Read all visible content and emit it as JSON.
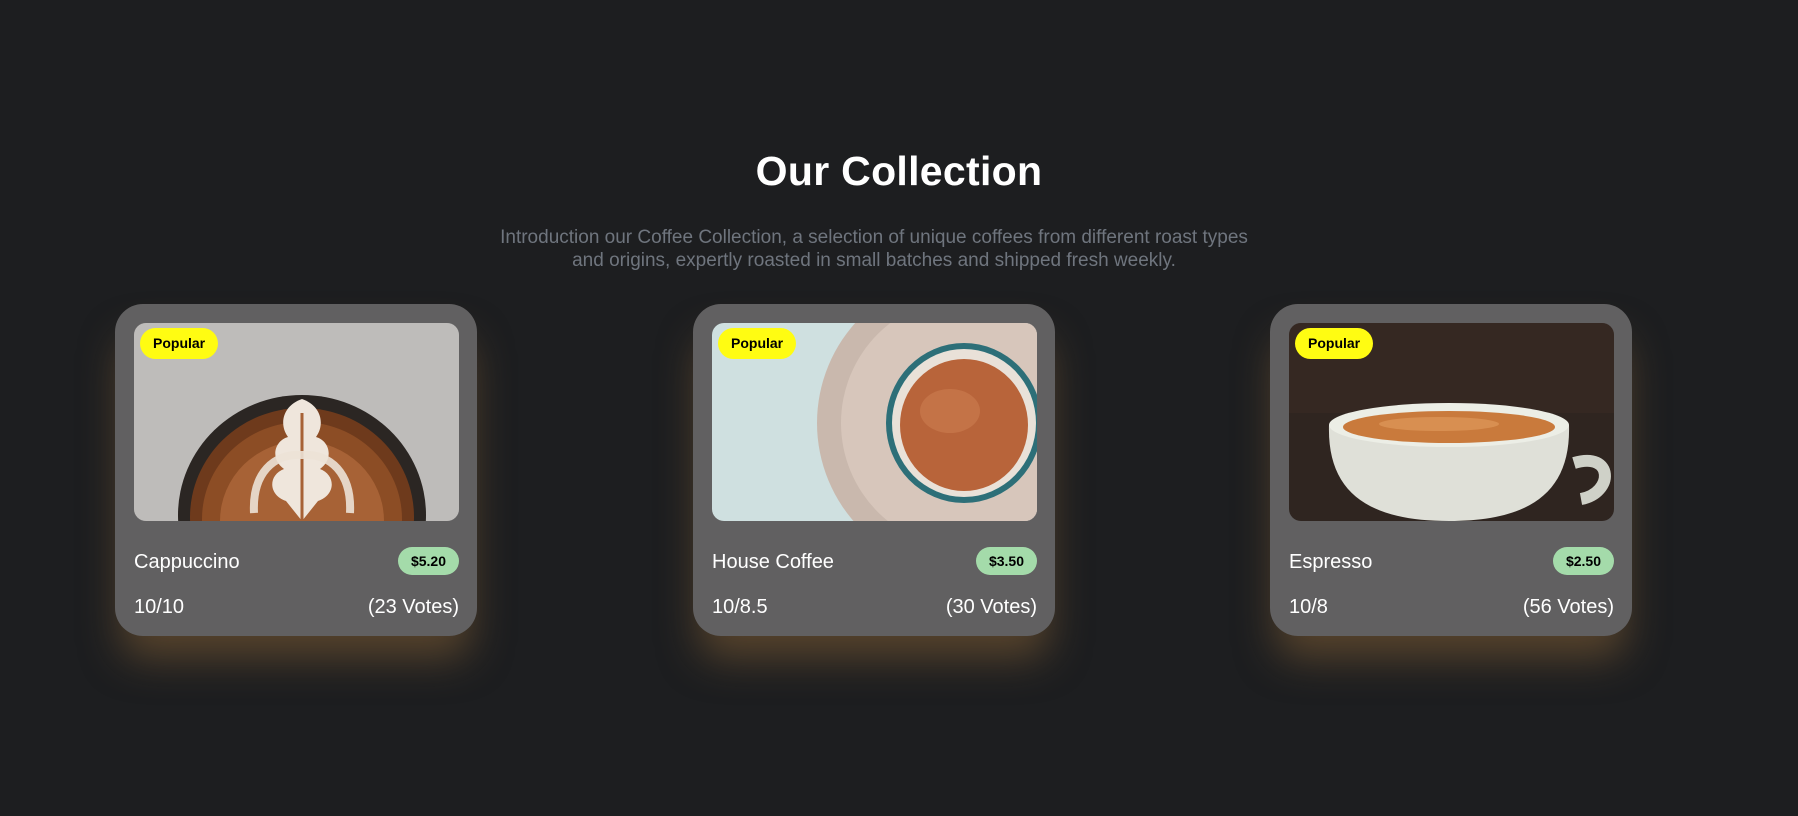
{
  "collection": {
    "title": "Our Collection",
    "intro": "Introduction our Coffee Collection, a selection of unique coffees from different roast types and origins, expertly roasted in small batches and shipped fresh weekly."
  },
  "products": [
    {
      "badge": "Popular",
      "name": "Cappuccino",
      "price": "$5.20",
      "rating": "10/10",
      "votes": "(23 Votes)",
      "image": "cappuccino-latte-art-photo"
    },
    {
      "badge": "Popular",
      "name": "House Coffee",
      "price": "$3.50",
      "rating": "10/8.5",
      "votes": "(30 Votes)",
      "image": "house-coffee-cup-on-saucer-photo"
    },
    {
      "badge": "Popular",
      "name": "Espresso",
      "price": "$2.50",
      "rating": "10/8",
      "votes": "(56 Votes)",
      "image": "espresso-white-cup-photo"
    }
  ],
  "colors": {
    "background": "#1d1e20",
    "card": "#616061",
    "badge_popular": "#fffc12",
    "price_badge": "#a4dbaa",
    "intro_text": "#6f757e",
    "card_glow": "#876237"
  }
}
